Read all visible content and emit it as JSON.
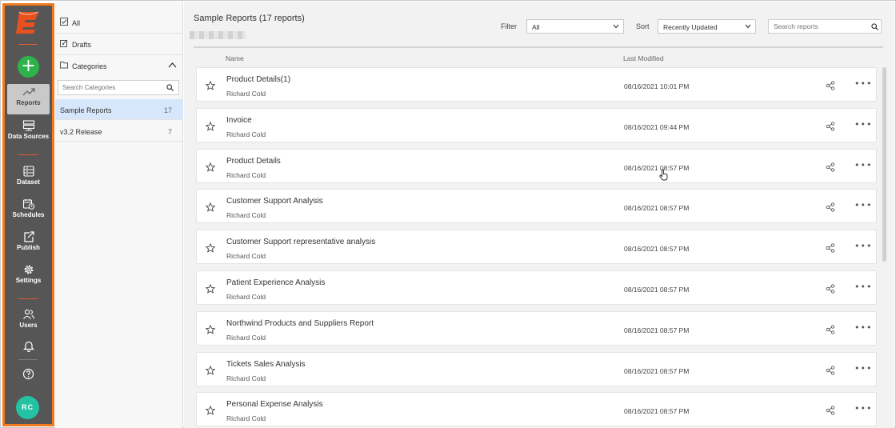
{
  "colors": {
    "nav_bg": "#565656",
    "nav_border": "#f07a1f",
    "brand": "#e8501e",
    "add": "#2db34a",
    "avatar": "#22c2a3",
    "selected": "#d7e7fb"
  },
  "nav": {
    "items": [
      {
        "label": "Reports",
        "icon": "trend-icon",
        "active": true
      },
      {
        "label": "Data Sources",
        "icon": "database-icon"
      },
      {
        "label": "Dataset",
        "icon": "dataset-icon"
      },
      {
        "label": "Schedules",
        "icon": "calendar-clock-icon"
      },
      {
        "label": "Publish",
        "icon": "publish-icon"
      },
      {
        "label": "Settings",
        "icon": "gear-icon"
      },
      {
        "label": "Users",
        "icon": "users-icon"
      }
    ],
    "avatar": "RC"
  },
  "categories": {
    "all": "All",
    "drafts": "Drafts",
    "header": "Categories",
    "search_placeholder": "Search Categories",
    "items": [
      {
        "label": "Sample Reports",
        "count": "17"
      },
      {
        "label": "v3.2 Release",
        "count": "7"
      }
    ]
  },
  "main": {
    "title": "Sample Reports (17 reports)",
    "filter_label": "Filter",
    "filter_value": "All",
    "sort_label": "Sort",
    "sort_value": "Recently Updated",
    "search_placeholder": "Search reports",
    "col_name": "Name",
    "col_modified": "Last Modified"
  },
  "reports": [
    {
      "name": "Product Details(1)",
      "owner": "Richard Cold",
      "modified": "08/16/2021 10:01 PM"
    },
    {
      "name": "Invoice",
      "owner": "Richard Cold",
      "modified": "08/16/2021 09:44 PM"
    },
    {
      "name": "Product Details",
      "owner": "Richard Cold",
      "modified": "08/16/2021 08:57 PM"
    },
    {
      "name": "Customer Support Analysis",
      "owner": "Richard Cold",
      "modified": "08/16/2021 08:57 PM"
    },
    {
      "name": "Customer Support representative analysis",
      "owner": "Richard Cold",
      "modified": "08/16/2021 08:57 PM"
    },
    {
      "name": "Patient Experience Analysis",
      "owner": "Richard Cold",
      "modified": "08/16/2021 08:57 PM"
    },
    {
      "name": "Northwind Products and Suppliers Report",
      "owner": "Richard Cold",
      "modified": "08/16/2021 08:57 PM"
    },
    {
      "name": "Tickets Sales Analysis",
      "owner": "Richard Cold",
      "modified": "08/16/2021 08:57 PM"
    },
    {
      "name": "Personal Expense Analysis",
      "owner": "Richard Cold",
      "modified": "08/16/2021 08:57 PM"
    }
  ]
}
